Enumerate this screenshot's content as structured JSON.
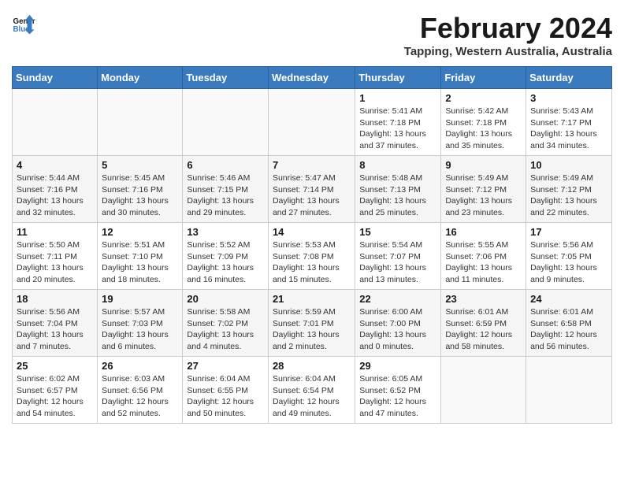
{
  "header": {
    "logo_line1": "General",
    "logo_line2": "Blue",
    "month_title": "February 2024",
    "location": "Tapping, Western Australia, Australia"
  },
  "weekdays": [
    "Sunday",
    "Monday",
    "Tuesday",
    "Wednesday",
    "Thursday",
    "Friday",
    "Saturday"
  ],
  "weeks": [
    [
      {
        "day": "",
        "sunrise": "",
        "sunset": "",
        "daylight": ""
      },
      {
        "day": "",
        "sunrise": "",
        "sunset": "",
        "daylight": ""
      },
      {
        "day": "",
        "sunrise": "",
        "sunset": "",
        "daylight": ""
      },
      {
        "day": "",
        "sunrise": "",
        "sunset": "",
        "daylight": ""
      },
      {
        "day": "1",
        "sunrise": "Sunrise: 5:41 AM",
        "sunset": "Sunset: 7:18 PM",
        "daylight": "Daylight: 13 hours and 37 minutes."
      },
      {
        "day": "2",
        "sunrise": "Sunrise: 5:42 AM",
        "sunset": "Sunset: 7:18 PM",
        "daylight": "Daylight: 13 hours and 35 minutes."
      },
      {
        "day": "3",
        "sunrise": "Sunrise: 5:43 AM",
        "sunset": "Sunset: 7:17 PM",
        "daylight": "Daylight: 13 hours and 34 minutes."
      }
    ],
    [
      {
        "day": "4",
        "sunrise": "Sunrise: 5:44 AM",
        "sunset": "Sunset: 7:16 PM",
        "daylight": "Daylight: 13 hours and 32 minutes."
      },
      {
        "day": "5",
        "sunrise": "Sunrise: 5:45 AM",
        "sunset": "Sunset: 7:16 PM",
        "daylight": "Daylight: 13 hours and 30 minutes."
      },
      {
        "day": "6",
        "sunrise": "Sunrise: 5:46 AM",
        "sunset": "Sunset: 7:15 PM",
        "daylight": "Daylight: 13 hours and 29 minutes."
      },
      {
        "day": "7",
        "sunrise": "Sunrise: 5:47 AM",
        "sunset": "Sunset: 7:14 PM",
        "daylight": "Daylight: 13 hours and 27 minutes."
      },
      {
        "day": "8",
        "sunrise": "Sunrise: 5:48 AM",
        "sunset": "Sunset: 7:13 PM",
        "daylight": "Daylight: 13 hours and 25 minutes."
      },
      {
        "day": "9",
        "sunrise": "Sunrise: 5:49 AM",
        "sunset": "Sunset: 7:12 PM",
        "daylight": "Daylight: 13 hours and 23 minutes."
      },
      {
        "day": "10",
        "sunrise": "Sunrise: 5:49 AM",
        "sunset": "Sunset: 7:12 PM",
        "daylight": "Daylight: 13 hours and 22 minutes."
      }
    ],
    [
      {
        "day": "11",
        "sunrise": "Sunrise: 5:50 AM",
        "sunset": "Sunset: 7:11 PM",
        "daylight": "Daylight: 13 hours and 20 minutes."
      },
      {
        "day": "12",
        "sunrise": "Sunrise: 5:51 AM",
        "sunset": "Sunset: 7:10 PM",
        "daylight": "Daylight: 13 hours and 18 minutes."
      },
      {
        "day": "13",
        "sunrise": "Sunrise: 5:52 AM",
        "sunset": "Sunset: 7:09 PM",
        "daylight": "Daylight: 13 hours and 16 minutes."
      },
      {
        "day": "14",
        "sunrise": "Sunrise: 5:53 AM",
        "sunset": "Sunset: 7:08 PM",
        "daylight": "Daylight: 13 hours and 15 minutes."
      },
      {
        "day": "15",
        "sunrise": "Sunrise: 5:54 AM",
        "sunset": "Sunset: 7:07 PM",
        "daylight": "Daylight: 13 hours and 13 minutes."
      },
      {
        "day": "16",
        "sunrise": "Sunrise: 5:55 AM",
        "sunset": "Sunset: 7:06 PM",
        "daylight": "Daylight: 13 hours and 11 minutes."
      },
      {
        "day": "17",
        "sunrise": "Sunrise: 5:56 AM",
        "sunset": "Sunset: 7:05 PM",
        "daylight": "Daylight: 13 hours and 9 minutes."
      }
    ],
    [
      {
        "day": "18",
        "sunrise": "Sunrise: 5:56 AM",
        "sunset": "Sunset: 7:04 PM",
        "daylight": "Daylight: 13 hours and 7 minutes."
      },
      {
        "day": "19",
        "sunrise": "Sunrise: 5:57 AM",
        "sunset": "Sunset: 7:03 PM",
        "daylight": "Daylight: 13 hours and 6 minutes."
      },
      {
        "day": "20",
        "sunrise": "Sunrise: 5:58 AM",
        "sunset": "Sunset: 7:02 PM",
        "daylight": "Daylight: 13 hours and 4 minutes."
      },
      {
        "day": "21",
        "sunrise": "Sunrise: 5:59 AM",
        "sunset": "Sunset: 7:01 PM",
        "daylight": "Daylight: 13 hours and 2 minutes."
      },
      {
        "day": "22",
        "sunrise": "Sunrise: 6:00 AM",
        "sunset": "Sunset: 7:00 PM",
        "daylight": "Daylight: 13 hours and 0 minutes."
      },
      {
        "day": "23",
        "sunrise": "Sunrise: 6:01 AM",
        "sunset": "Sunset: 6:59 PM",
        "daylight": "Daylight: 12 hours and 58 minutes."
      },
      {
        "day": "24",
        "sunrise": "Sunrise: 6:01 AM",
        "sunset": "Sunset: 6:58 PM",
        "daylight": "Daylight: 12 hours and 56 minutes."
      }
    ],
    [
      {
        "day": "25",
        "sunrise": "Sunrise: 6:02 AM",
        "sunset": "Sunset: 6:57 PM",
        "daylight": "Daylight: 12 hours and 54 minutes."
      },
      {
        "day": "26",
        "sunrise": "Sunrise: 6:03 AM",
        "sunset": "Sunset: 6:56 PM",
        "daylight": "Daylight: 12 hours and 52 minutes."
      },
      {
        "day": "27",
        "sunrise": "Sunrise: 6:04 AM",
        "sunset": "Sunset: 6:55 PM",
        "daylight": "Daylight: 12 hours and 50 minutes."
      },
      {
        "day": "28",
        "sunrise": "Sunrise: 6:04 AM",
        "sunset": "Sunset: 6:54 PM",
        "daylight": "Daylight: 12 hours and 49 minutes."
      },
      {
        "day": "29",
        "sunrise": "Sunrise: 6:05 AM",
        "sunset": "Sunset: 6:52 PM",
        "daylight": "Daylight: 12 hours and 47 minutes."
      },
      {
        "day": "",
        "sunrise": "",
        "sunset": "",
        "daylight": ""
      },
      {
        "day": "",
        "sunrise": "",
        "sunset": "",
        "daylight": ""
      }
    ]
  ]
}
